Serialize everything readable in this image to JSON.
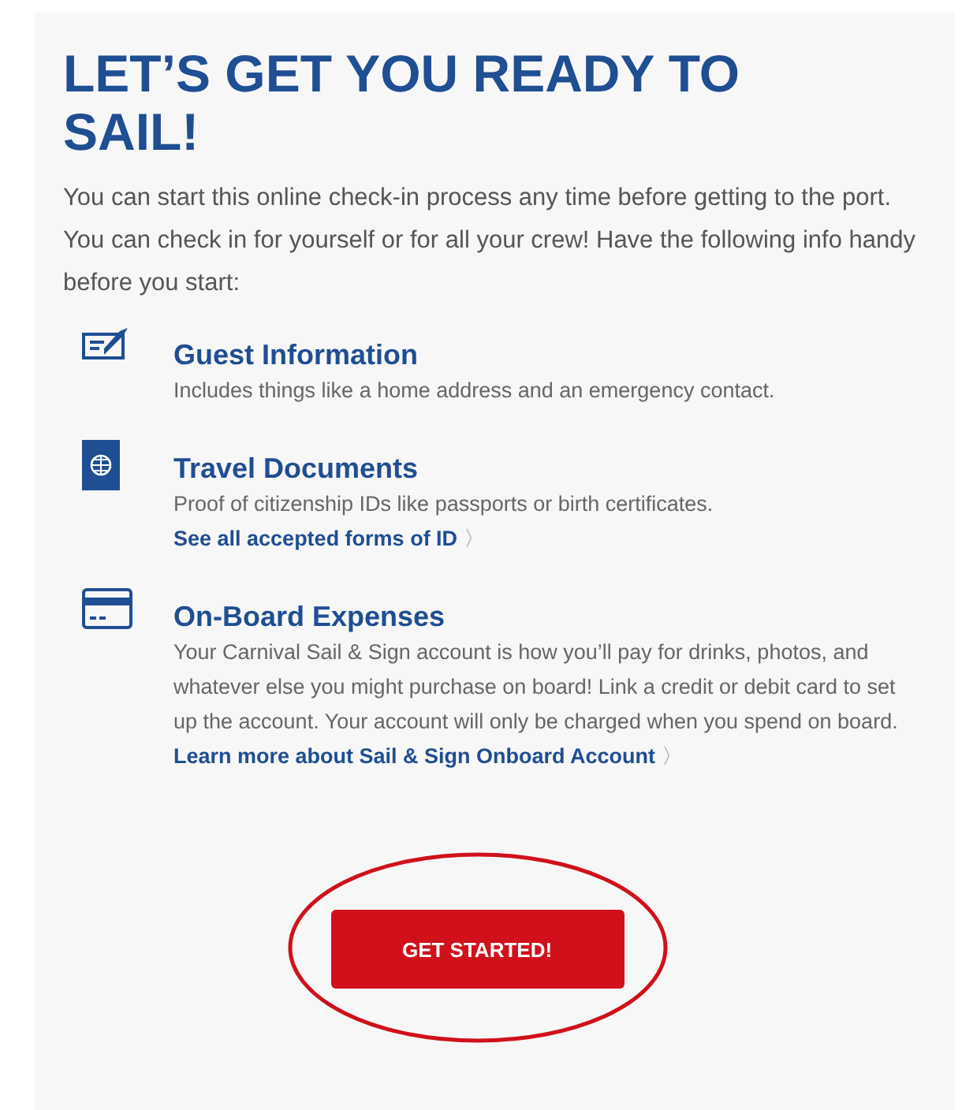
{
  "heading": "LET’S GET YOU READY TO SAIL!",
  "intro": "You can start this online check-in process any time before getting to the port. You can check in for yourself or for all your crew! Have the following info handy before you start:",
  "items": [
    {
      "kind": "form",
      "title": "Guest Information",
      "text": "Includes things like a home address and an emergency contact."
    },
    {
      "kind": "passport",
      "title": "Travel Documents",
      "text": "Proof of citizenship IDs like passports or birth certificates.",
      "link": "See all accepted forms of ID",
      "chevron": "〉"
    },
    {
      "kind": "card",
      "title": "On-Board Expenses",
      "text": "Your Carnival Sail & Sign account is how you’ll pay for drinks, photos, and whatever else you might purchase on board! Link a credit or debit card to set up the account. Your account will only be charged when you spend on board.",
      "link": "Learn more about Sail & Sign Onboard Account",
      "chevron": "〉"
    }
  ],
  "button": {
    "label": "GET STARTED!",
    "circled": true
  }
}
